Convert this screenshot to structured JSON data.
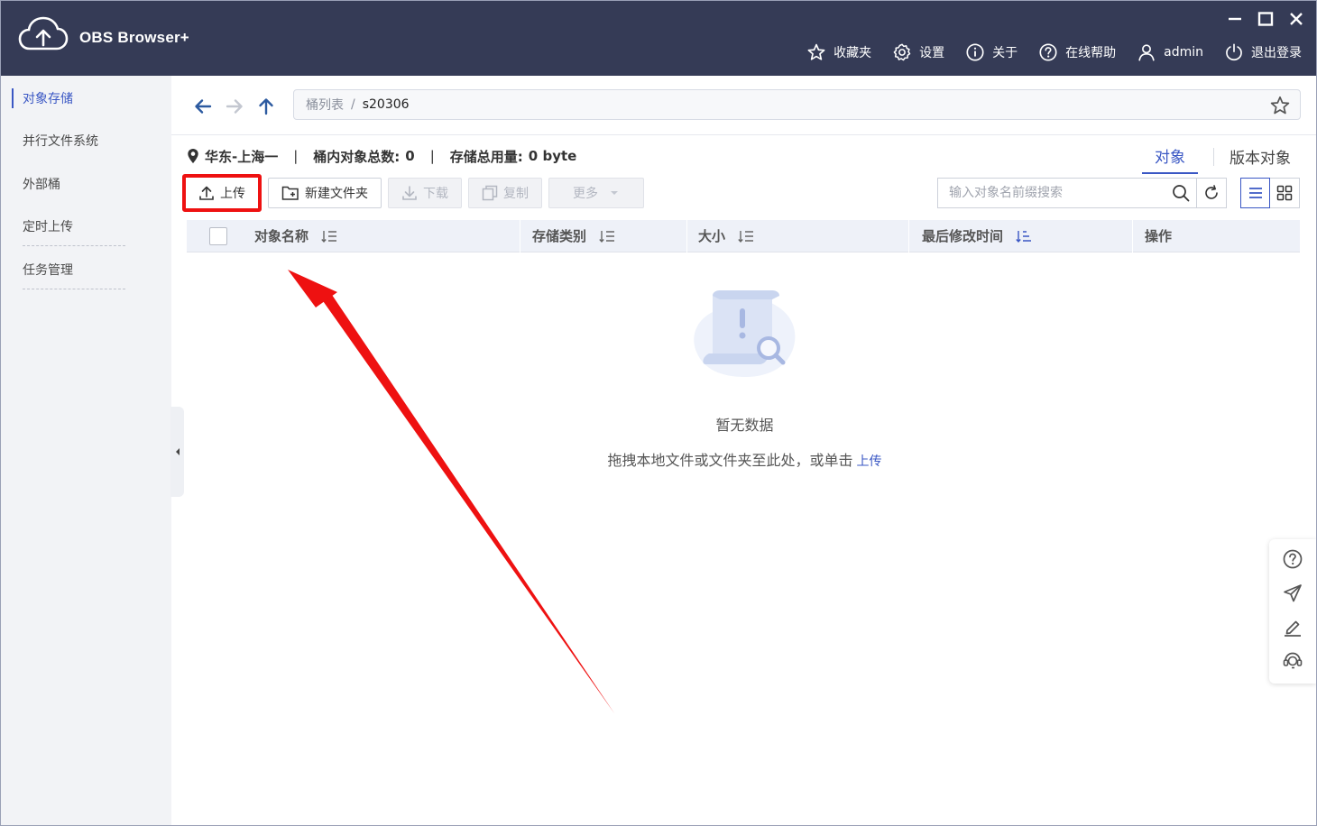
{
  "app": {
    "title": "OBS Browser+"
  },
  "top_menu": {
    "favorites": "收藏夹",
    "settings": "设置",
    "about": "关于",
    "help": "在线帮助",
    "user": "admin",
    "logout": "退出登录"
  },
  "sidebar": {
    "items": [
      {
        "label": "对象存储"
      },
      {
        "label": "并行文件系统"
      },
      {
        "label": "外部桶"
      },
      {
        "label": "定时上传"
      },
      {
        "label": "任务管理"
      }
    ]
  },
  "breadcrumb": {
    "root": "桶列表",
    "separator": "/",
    "current": "s20306"
  },
  "info": {
    "region": "华东-上海一",
    "count_label": "桶内对象总数:",
    "count_value": "0",
    "usage_label": "存储总用量:",
    "usage_value": "0 byte"
  },
  "tabs": {
    "objects": "对象",
    "versions": "版本对象"
  },
  "toolbar": {
    "upload": "上传",
    "new_folder": "新建文件夹",
    "download": "下载",
    "copy": "复制",
    "more": "更多"
  },
  "search": {
    "placeholder": "输入对象名前缀搜索"
  },
  "table": {
    "columns": [
      {
        "label": "对象名称"
      },
      {
        "label": "存储类别"
      },
      {
        "label": "大小"
      },
      {
        "label": "最后修改时间"
      },
      {
        "label": "操作"
      }
    ]
  },
  "empty": {
    "title": "暂无数据",
    "desc": "拖拽本地文件或文件夹至此处，或单击",
    "link": "上传"
  },
  "colors": {
    "accent": "#3a57c4",
    "titlebar": "#353b56",
    "highlight": "#ee1111"
  }
}
